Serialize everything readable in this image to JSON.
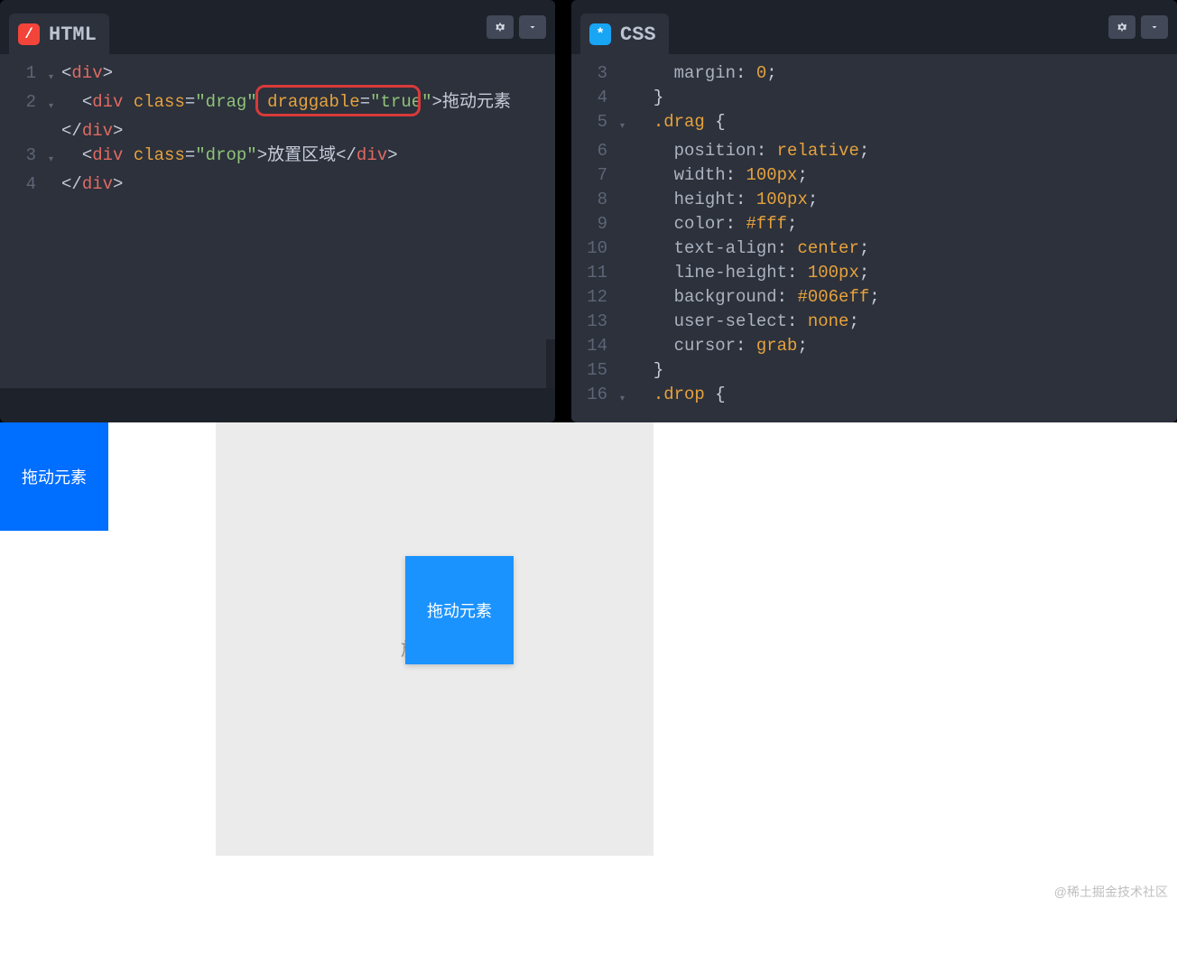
{
  "panes": {
    "html": {
      "title": "HTML",
      "icon_glyph": "/"
    },
    "css": {
      "title": "CSS",
      "icon_glyph": "*"
    }
  },
  "html_code": {
    "lines": [
      {
        "num": "1",
        "fold": true,
        "indent": "",
        "parts": [
          {
            "t": "<",
            "c": "punct"
          },
          {
            "t": "div",
            "c": "tag"
          },
          {
            "t": ">",
            "c": "punct"
          }
        ]
      },
      {
        "num": "2",
        "fold": true,
        "indent": "  ",
        "parts": [
          {
            "t": "<",
            "c": "punct"
          },
          {
            "t": "div",
            "c": "tag"
          },
          {
            "t": " ",
            "c": "code"
          },
          {
            "t": "class",
            "c": "attr"
          },
          {
            "t": "=",
            "c": "punct"
          },
          {
            "t": "\"drag\"",
            "c": "str"
          },
          {
            "t": " ",
            "c": "code"
          },
          {
            "t": "draggable",
            "c": "attr"
          },
          {
            "t": "=",
            "c": "punct"
          },
          {
            "t": "\"true\"",
            "c": "str"
          },
          {
            "t": ">",
            "c": "punct"
          },
          {
            "t": "拖动元素",
            "c": "code"
          }
        ]
      },
      {
        "num": "",
        "fold": false,
        "indent": "",
        "parts": [
          {
            "t": "</",
            "c": "punct"
          },
          {
            "t": "div",
            "c": "tag"
          },
          {
            "t": ">",
            "c": "punct"
          }
        ]
      },
      {
        "num": "3",
        "fold": true,
        "indent": "  ",
        "parts": [
          {
            "t": "<",
            "c": "punct"
          },
          {
            "t": "div",
            "c": "tag"
          },
          {
            "t": " ",
            "c": "code"
          },
          {
            "t": "class",
            "c": "attr"
          },
          {
            "t": "=",
            "c": "punct"
          },
          {
            "t": "\"drop\"",
            "c": "str"
          },
          {
            "t": ">",
            "c": "punct"
          },
          {
            "t": "放置区域",
            "c": "code"
          },
          {
            "t": "</",
            "c": "punct"
          },
          {
            "t": "div",
            "c": "tag"
          },
          {
            "t": ">",
            "c": "punct"
          }
        ]
      },
      {
        "num": "4",
        "fold": false,
        "indent": "",
        "parts": [
          {
            "t": "</",
            "c": "punct"
          },
          {
            "t": "div",
            "c": "tag"
          },
          {
            "t": ">",
            "c": "punct"
          }
        ]
      }
    ]
  },
  "css_code": {
    "lines": [
      {
        "num": "3",
        "indent": "    ",
        "parts": [
          {
            "t": "margin",
            "c": "css-kw"
          },
          {
            "t": ": ",
            "c": "punct"
          },
          {
            "t": "0",
            "c": "num"
          },
          {
            "t": ";",
            "c": "punct"
          }
        ]
      },
      {
        "num": "4",
        "indent": "  ",
        "parts": [
          {
            "t": "}",
            "c": "punct"
          }
        ]
      },
      {
        "num": "5",
        "indent": "  ",
        "fold": true,
        "parts": [
          {
            "t": ".drag",
            "c": "sel"
          },
          {
            "t": " {",
            "c": "punct"
          }
        ]
      },
      {
        "num": "6",
        "indent": "    ",
        "parts": [
          {
            "t": "position",
            "c": "css-kw"
          },
          {
            "t": ": ",
            "c": "punct"
          },
          {
            "t": "relative",
            "c": "val"
          },
          {
            "t": ";",
            "c": "punct"
          }
        ]
      },
      {
        "num": "7",
        "indent": "    ",
        "parts": [
          {
            "t": "width",
            "c": "css-kw"
          },
          {
            "t": ": ",
            "c": "punct"
          },
          {
            "t": "100px",
            "c": "num"
          },
          {
            "t": ";",
            "c": "punct"
          }
        ]
      },
      {
        "num": "8",
        "indent": "    ",
        "parts": [
          {
            "t": "height",
            "c": "css-kw"
          },
          {
            "t": ": ",
            "c": "punct"
          },
          {
            "t": "100px",
            "c": "num"
          },
          {
            "t": ";",
            "c": "punct"
          }
        ]
      },
      {
        "num": "9",
        "indent": "    ",
        "parts": [
          {
            "t": "color",
            "c": "css-kw"
          },
          {
            "t": ": ",
            "c": "punct"
          },
          {
            "t": "#fff",
            "c": "val"
          },
          {
            "t": ";",
            "c": "punct"
          }
        ]
      },
      {
        "num": "10",
        "indent": "    ",
        "parts": [
          {
            "t": "text-align",
            "c": "css-kw"
          },
          {
            "t": ": ",
            "c": "punct"
          },
          {
            "t": "center",
            "c": "val"
          },
          {
            "t": ";",
            "c": "punct"
          }
        ]
      },
      {
        "num": "11",
        "indent": "    ",
        "parts": [
          {
            "t": "line-height",
            "c": "css-kw"
          },
          {
            "t": ": ",
            "c": "punct"
          },
          {
            "t": "100px",
            "c": "num"
          },
          {
            "t": ";",
            "c": "punct"
          }
        ]
      },
      {
        "num": "12",
        "indent": "    ",
        "parts": [
          {
            "t": "background",
            "c": "css-kw"
          },
          {
            "t": ": ",
            "c": "punct"
          },
          {
            "t": "#006eff",
            "c": "val"
          },
          {
            "t": ";",
            "c": "punct"
          }
        ]
      },
      {
        "num": "13",
        "indent": "    ",
        "parts": [
          {
            "t": "user-select",
            "c": "css-kw"
          },
          {
            "t": ": ",
            "c": "punct"
          },
          {
            "t": "none",
            "c": "val"
          },
          {
            "t": ";",
            "c": "punct"
          }
        ]
      },
      {
        "num": "14",
        "indent": "    ",
        "parts": [
          {
            "t": "cursor",
            "c": "css-kw"
          },
          {
            "t": ": ",
            "c": "punct"
          },
          {
            "t": "grab",
            "c": "val"
          },
          {
            "t": ";",
            "c": "punct"
          }
        ]
      },
      {
        "num": "15",
        "indent": "  ",
        "parts": [
          {
            "t": "}",
            "c": "punct"
          }
        ]
      },
      {
        "num": "16",
        "indent": "  ",
        "fold": true,
        "parts": [
          {
            "t": ".drop",
            "c": "sel"
          },
          {
            "t": " {",
            "c": "punct"
          }
        ]
      }
    ]
  },
  "preview": {
    "drag_label": "拖动元素",
    "drop_label": "放置区域"
  },
  "watermark": "@稀土掘金技术社区"
}
